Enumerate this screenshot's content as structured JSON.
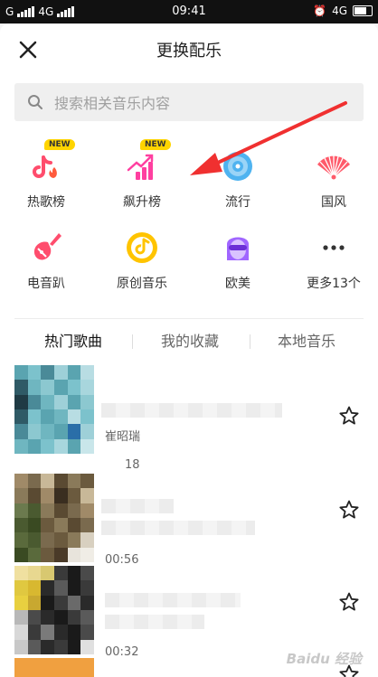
{
  "status_bar": {
    "carrier_left": "G",
    "network": "4G",
    "time": "09:41",
    "network_right": "4G"
  },
  "header": {
    "title": "更换配乐",
    "close_icon": "close-icon"
  },
  "search": {
    "placeholder": "搜索相关音乐内容"
  },
  "categories": [
    {
      "label": "热歌榜",
      "icon": "tiktok-fire-icon",
      "badge": "NEW",
      "color": "#ff4d6d"
    },
    {
      "label": "飙升榜",
      "icon": "rising-chart-icon",
      "badge": "NEW",
      "color": "#ff3fa0"
    },
    {
      "label": "流行",
      "icon": "disc-icon",
      "badge": "",
      "color": "#4fb3f0"
    },
    {
      "label": "国风",
      "icon": "fan-icon",
      "badge": "",
      "color": "#ff5a6a"
    },
    {
      "label": "电音趴",
      "icon": "electric-guitar-icon",
      "badge": "",
      "color": "#ff4d6d"
    },
    {
      "label": "原创音乐",
      "icon": "record-note-icon",
      "badge": "",
      "color": "#ffc400"
    },
    {
      "label": "欧美",
      "icon": "sunglasses-face-icon",
      "badge": "",
      "color": "#a066ff"
    },
    {
      "label": "更多13个",
      "icon": "more-dots-icon",
      "badge": "",
      "color": "#333333"
    }
  ],
  "tabs": [
    {
      "label": "热门歌曲",
      "active": true
    },
    {
      "label": "我的收藏",
      "active": false
    },
    {
      "label": "本地音乐",
      "active": false
    }
  ],
  "songs": [
    {
      "artist": "崔昭瑞",
      "duration": "18"
    },
    {
      "artist": "",
      "duration": "00:56"
    },
    {
      "artist": "",
      "duration": "00:32"
    }
  ],
  "watermark": "Baidu 经验"
}
